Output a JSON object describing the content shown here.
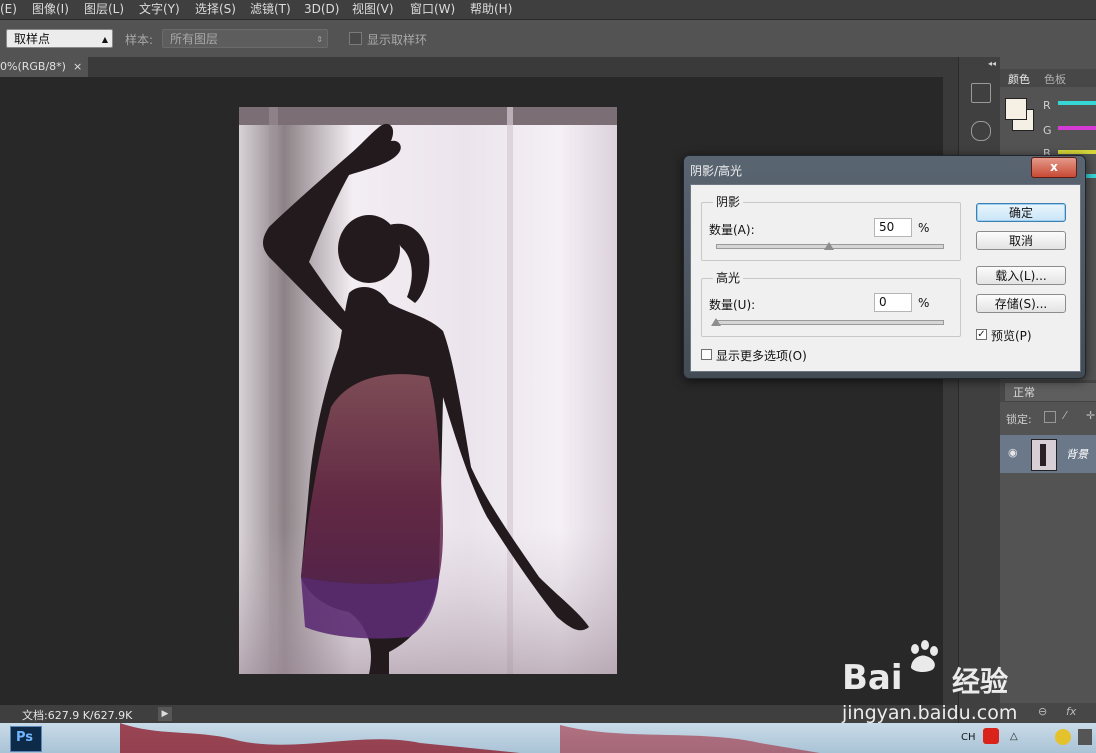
{
  "menu": [
    "(E)",
    "图像(I)",
    "图层(L)",
    "文字(Y)",
    "选择(S)",
    "滤镜(T)",
    "3D(D)",
    "视图(V)",
    "窗口(W)",
    "帮助(H)"
  ],
  "options_bar": {
    "tool_select": "取样点",
    "sample_label": "样本:",
    "sample_select": "所有图层",
    "show_ring_label": "显示取样环"
  },
  "doc_tab": {
    "title": "0%(RGB/8*)",
    "close": "×"
  },
  "status": {
    "doc_info": "文档:627.9 K/627.9K",
    "arrow": "▶"
  },
  "panel": {
    "collapse": "◂◂",
    "tab_color": "颜色",
    "tab_swatches": "色板",
    "channels": [
      "R",
      "G",
      "B"
    ],
    "channel_colors": [
      "#36d6d6",
      "#d63ad6",
      "#d6d63a"
    ],
    "blend_mode": "正常",
    "lock_label": "锁定:",
    "layer_name": "背景",
    "footer_icons": [
      "link-icon",
      "fx-icon"
    ],
    "footer_fx": "fx"
  },
  "dialog": {
    "title": "阴影/高光",
    "close": "x",
    "shadows": {
      "title": "阴影",
      "amount_label": "数量(A):",
      "amount_value": "50",
      "unit": "%",
      "slider_fraction": 0.5
    },
    "highlights": {
      "title": "高光",
      "amount_label": "数量(U):",
      "amount_value": "0",
      "unit": "%",
      "slider_fraction": 0.0
    },
    "show_more": "显示更多选项(O)",
    "buttons": {
      "ok": "确定",
      "cancel": "取消",
      "load": "载入(L)...",
      "save": "存储(S)..."
    },
    "preview_label": "预览(P)",
    "preview_checked": true,
    "check_mark": "✓"
  },
  "taskbar": {
    "ps_label": "Ps",
    "lang": "CH",
    "tray_up": "△"
  },
  "watermark": {
    "brand": "Bai",
    "brand_suffix": "经验",
    "url": "jingyan.baidu.com"
  }
}
